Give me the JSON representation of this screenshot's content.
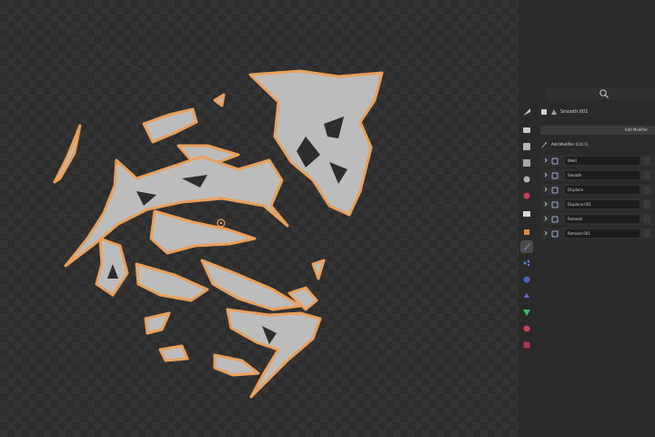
{
  "viewport": {
    "object_color": "#bdbcbc",
    "outline_color": "#e8a05c",
    "background_color": "#2d2d2d",
    "origin_marker": "object-origin-icon"
  },
  "properties": {
    "search_icon": "search-icon",
    "object_name": "Smooth.001",
    "add_modifier_label": "Add Modifier",
    "edit_modifier_label": "Add Modifier  (Ctrl 1)",
    "tabs": [
      {
        "icon": "tool-icon"
      },
      {
        "icon": "render-icon"
      },
      {
        "icon": "output-icon"
      },
      {
        "icon": "view-layer-icon"
      },
      {
        "icon": "scene-icon"
      },
      {
        "icon": "world-icon"
      },
      {
        "icon": "collection-icon"
      },
      {
        "icon": "object-icon"
      },
      {
        "icon": "modifier-icon"
      },
      {
        "icon": "particles-icon"
      },
      {
        "icon": "physics-icon"
      },
      {
        "icon": "constraints-icon"
      },
      {
        "icon": "data-icon"
      },
      {
        "icon": "material-icon"
      },
      {
        "icon": "texture-icon"
      }
    ],
    "modifiers": [
      {
        "name": "Weld"
      },
      {
        "name": "Smooth"
      },
      {
        "name": "Displace"
      },
      {
        "name": "Displace.001"
      },
      {
        "name": "Remesh"
      },
      {
        "name": "Remesh.001"
      }
    ]
  }
}
